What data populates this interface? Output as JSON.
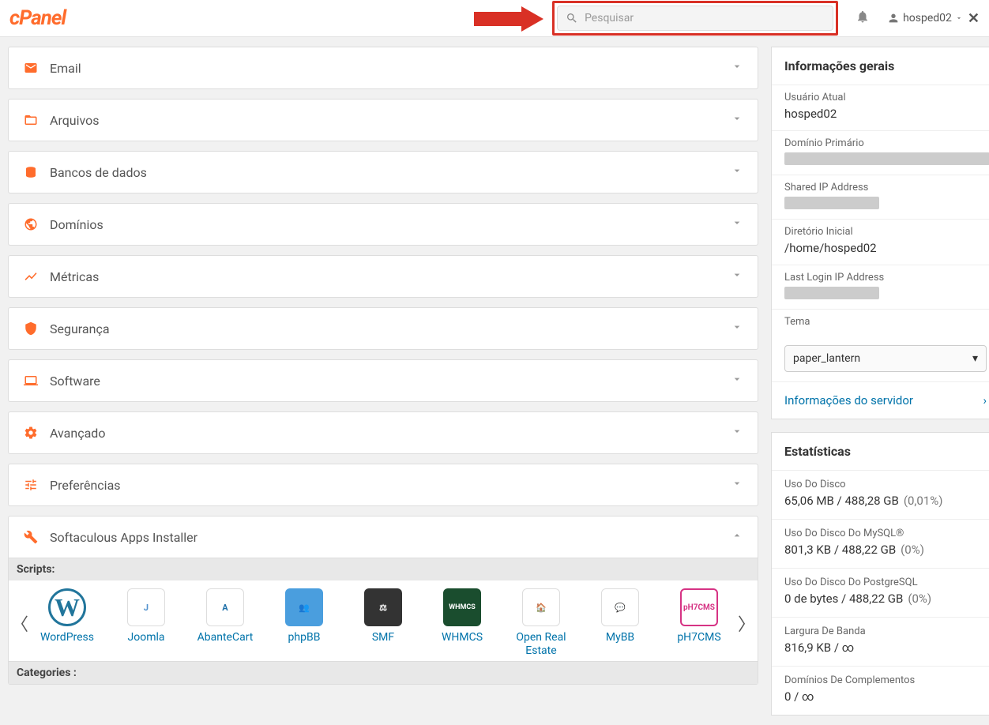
{
  "header": {
    "logo": "cPanel",
    "search_placeholder": "Pesquisar",
    "username": "hosped02"
  },
  "sections": [
    {
      "k": "email",
      "title": "Email"
    },
    {
      "k": "files",
      "title": "Arquivos"
    },
    {
      "k": "db",
      "title": "Bancos de dados"
    },
    {
      "k": "domains",
      "title": "Domínios"
    },
    {
      "k": "metrics",
      "title": "Métricas"
    },
    {
      "k": "security",
      "title": "Segurança"
    },
    {
      "k": "software",
      "title": "Software"
    },
    {
      "k": "advanced",
      "title": "Avançado"
    },
    {
      "k": "prefs",
      "title": "Preferências"
    }
  ],
  "softaculous": {
    "title": "Softaculous Apps Installer",
    "scripts_label": "Scripts:",
    "categories_label": "Categories :",
    "scripts": [
      {
        "name": "WordPress",
        "bg": "#fff",
        "txt": "#21759b",
        "short": "W",
        "style": "wp"
      },
      {
        "name": "Joomla",
        "bg": "#fff",
        "txt": "#5091cd",
        "short": "J",
        "style": "joomla"
      },
      {
        "name": "AbanteCart",
        "bg": "#fff",
        "txt": "#1b6ea8",
        "short": "A",
        "style": "abante"
      },
      {
        "name": "phpBB",
        "bg": "#4a9ede",
        "txt": "#fff",
        "short": "👥",
        "style": "phpbb"
      },
      {
        "name": "SMF",
        "bg": "#333",
        "txt": "#fff",
        "short": "⚖",
        "style": "smf"
      },
      {
        "name": "WHMCS",
        "bg": "#1a4d2e",
        "txt": "#fff",
        "short": "WHMCS",
        "style": "whmcs"
      },
      {
        "name": "Open Real Estate",
        "bg": "#fff",
        "txt": "#2e7dd1",
        "short": "🏠",
        "style": "ore"
      },
      {
        "name": "MyBB",
        "bg": "#fff",
        "txt": "#333",
        "short": "💬",
        "style": "mybb"
      },
      {
        "name": "pH7CMS",
        "bg": "#fff",
        "txt": "#d63384",
        "short": "pH7CMS",
        "style": "ph7"
      }
    ]
  },
  "general_info": {
    "title": "Informações gerais",
    "rows": {
      "current_user_label": "Usuário Atual",
      "current_user_value": "hosped02",
      "primary_domain_label": "Domínio Primário",
      "shared_ip_label": "Shared IP Address",
      "home_dir_label": "Diretório Inicial",
      "home_dir_value": "/home/hosped02",
      "last_login_label": "Last Login IP Address",
      "theme_label": "Tema",
      "theme_value": "paper_lantern",
      "server_info": "Informações do servidor"
    }
  },
  "stats": {
    "title": "Estatísticas",
    "rows": [
      {
        "label": "Uso Do Disco",
        "value": "65,06 MB / 488,28 GB",
        "pct": "(0,01%)"
      },
      {
        "label": "Uso Do Disco Do MySQL®",
        "value": "801,3 KB / 488,22 GB",
        "pct": "(0%)"
      },
      {
        "label": "Uso Do Disco Do PostgreSQL",
        "value": "0 de bytes / 488,22 GB",
        "pct": "(0%)"
      },
      {
        "label": "Largura De Banda",
        "value": "816,9 KB / ∞",
        "pct": ""
      },
      {
        "label": "Domínios De Complementos",
        "value": "0 / ∞",
        "pct": ""
      }
    ]
  }
}
